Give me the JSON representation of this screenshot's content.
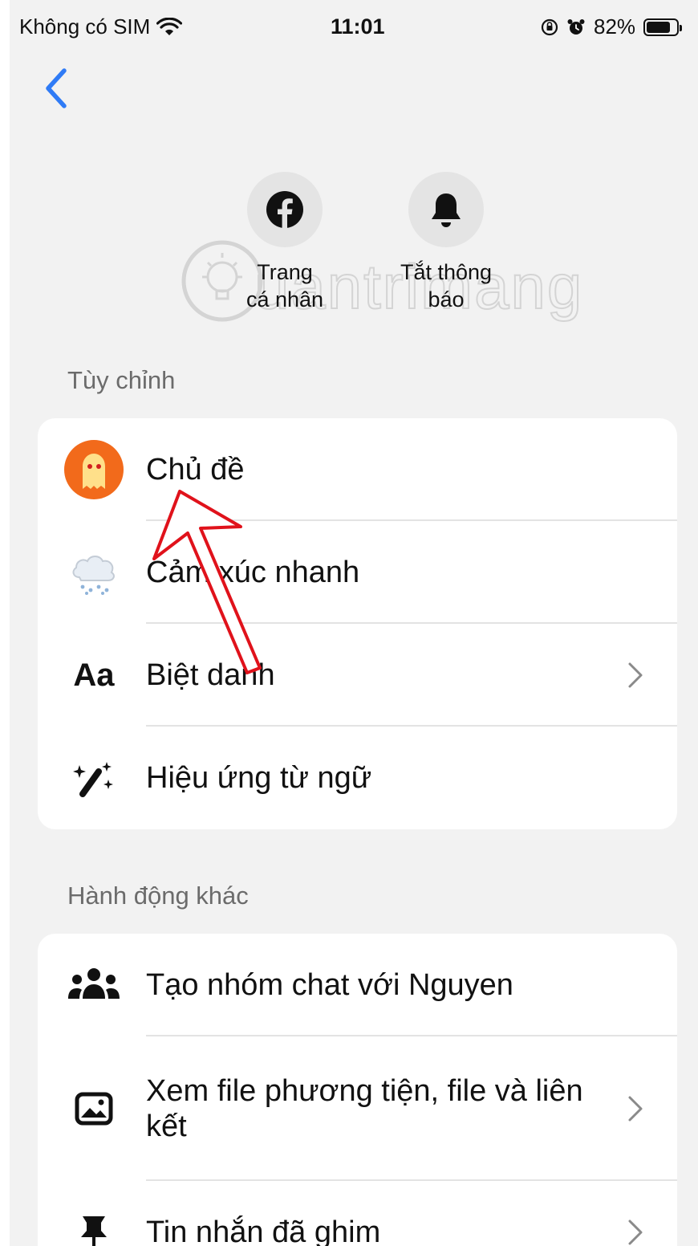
{
  "status_bar": {
    "carrier": "Không có SIM",
    "time": "11:01",
    "battery": "82%",
    "battery_level": 0.82
  },
  "quick_actions": [
    {
      "label": "Trang\ncá nhân",
      "icon": "facebook-icon"
    },
    {
      "label": "Tắt thông\nbáo",
      "icon": "bell-icon"
    }
  ],
  "watermark": "uantrimang",
  "customize": {
    "title": "Tùy chỉnh",
    "items": [
      {
        "label": "Chủ đề",
        "icon": "theme-ghost-icon"
      },
      {
        "label": "Cảm xúc nhanh",
        "icon": "snow-cloud-icon"
      },
      {
        "label": "Biệt danh",
        "icon": "aa-text-icon",
        "icon_text": "Aa"
      },
      {
        "label": "Hiệu ứng từ ngữ",
        "icon": "magic-wand-icon"
      }
    ]
  },
  "other_actions": {
    "title": "Hành động khác",
    "items": [
      {
        "label": "Tạo nhóm chat với Nguyen",
        "icon": "group-icon"
      },
      {
        "label": "Xem file phương tiện, file và liên kết",
        "icon": "image-icon"
      },
      {
        "label": "Tin nhắn đã ghim",
        "icon": "pin-icon"
      }
    ]
  },
  "colors": {
    "accent": "#2f7bf6",
    "background": "#f2f2f2",
    "annotation_arrow": "#e0121b",
    "theme_orange": "#f26a1b"
  }
}
